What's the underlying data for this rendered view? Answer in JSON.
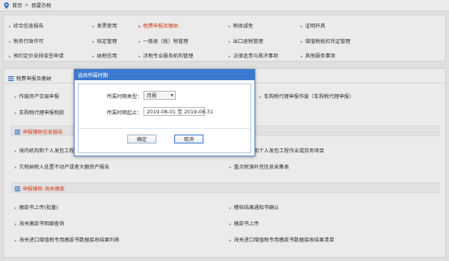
{
  "breadcrumb": {
    "home": "首页",
    "separator": ">",
    "current": "我要办税"
  },
  "menu": {
    "items": [
      {
        "label": "综合信息报告",
        "active": false
      },
      {
        "label": "发票使用",
        "active": false
      },
      {
        "label": "税费申报及缴纳",
        "active": true
      },
      {
        "label": "税收减免",
        "active": false
      },
      {
        "label": "证明开具",
        "active": false
      },
      {
        "label": "税务行政许可",
        "active": false
      },
      {
        "label": "核定管理",
        "active": false
      },
      {
        "label": "一般退（抵）税管理",
        "active": false
      },
      {
        "label": "出口退税管理",
        "active": false
      },
      {
        "label": "增值税抵扣凭证管理",
        "active": false
      },
      {
        "label": "预约定价安排谈签申请",
        "active": false
      },
      {
        "label": "纳税信用",
        "active": false
      },
      {
        "label": "涉税专业服务机构管理",
        "active": false
      },
      {
        "label": "法律追责与救济事项",
        "active": false
      },
      {
        "label": "其他服务事项",
        "active": false
      }
    ]
  },
  "main_section": {
    "title": "税费申报及缴纳",
    "items": [
      "作废房产交易申报",
      "车购税代理申报作废（车购税代理申报）",
      "车购税代理申报税款"
    ]
  },
  "aux_section": {
    "title": "申报辅助信息报告",
    "items": [
      "境内机构和个人发包工程作业或劳务项目",
      "境内机构和个人发包工程作业或劳务项目",
      "欠税纳税人处置不动产或者大额资产报告",
      "重点税源补充信息采集表"
    ]
  },
  "customs_section": {
    "title": "申报辅助-海关缴款",
    "items": [
      "缴款书上传(批量)",
      "稽核结果通知书确认",
      "海关缴款书明细查询",
      "缴款书上传",
      "海关进口增值税专用缴款书数据接收结果列表",
      "海关进口增值税专用缴款书数据接收结果清单"
    ]
  },
  "dialog": {
    "title": "选择所属时期",
    "period_type_label": "所属时期类型：",
    "period_type_value": "月报",
    "period_range_label": "所属时期起止：",
    "period_range_value": "2019-08-01 至 2019-08-31",
    "confirm_label": "确定",
    "cancel_label": "取消"
  },
  "colors": {
    "accent": "#e0401c",
    "dialog_header": "#3b7ad0",
    "icon_blue": "#3b7ad0"
  }
}
